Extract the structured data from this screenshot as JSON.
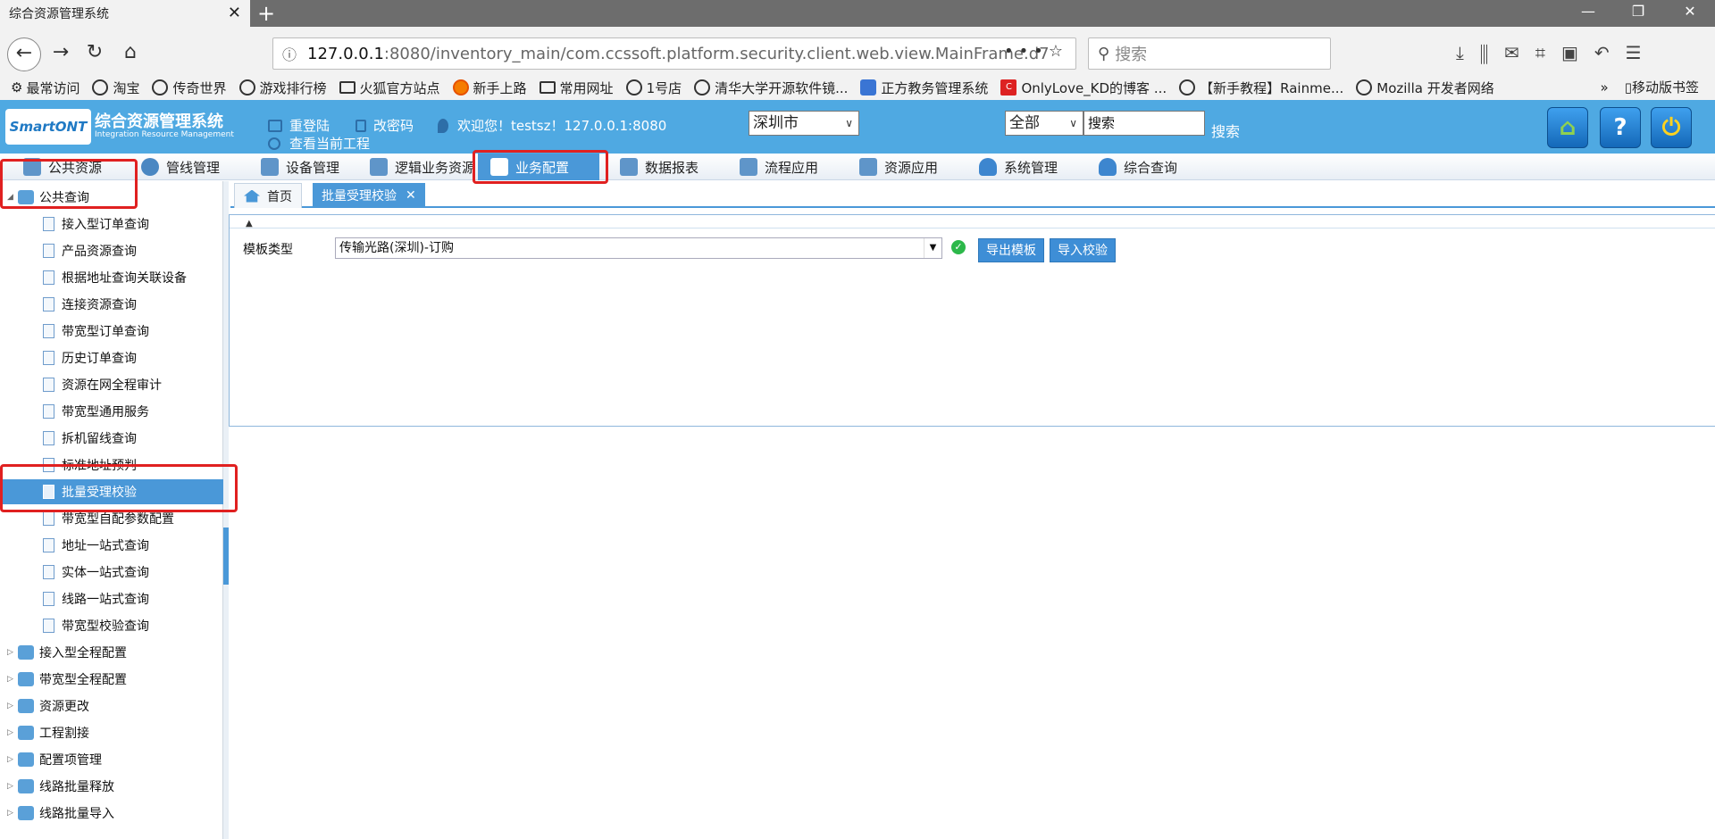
{
  "browser": {
    "tab_title": "综合资源管理系统",
    "url_host": "127.0.0.1",
    "url_rest": ":8080/inventory_main/com.ccssoft.platform.security.client.web.view.MainFrame.d7",
    "search_placeholder": "搜索",
    "bookmarks": [
      "最常访问",
      "淘宝",
      "传奇世界",
      "游戏排行榜",
      "火狐官方站点",
      "新手上路",
      "常用网址",
      "1号店",
      "清华大学开源软件镜...",
      "正方教务管理系统",
      "OnlyLove_KD的博客 ...",
      "【新手教程】Rainme...",
      "Mozilla 开发者网络"
    ],
    "bookmarks_more": "移动版书签"
  },
  "app": {
    "logo_text": "SmartONT",
    "title": "综合资源管理系统",
    "subtitle": "Integration Resource Management",
    "relogin": "重登陆",
    "change_password": "改密码",
    "welcome": "欢迎您！testsz！127.0.0.1:8080",
    "current_project": "查看当前工程",
    "city": "深圳市",
    "scope": "全部",
    "search_value": "搜索",
    "search_button": "搜索"
  },
  "modules": [
    "公共资源",
    "管线管理",
    "设备管理",
    "逻辑业务资源",
    "业务配置",
    "数据报表",
    "流程应用",
    "资源应用",
    "系统管理",
    "综合查询"
  ],
  "tree": {
    "root": "公共查询",
    "leaves": [
      "接入型订单查询",
      "产品资源查询",
      "根据地址查询关联设备",
      "连接资源查询",
      "带宽型订单查询",
      "历史订单查询",
      "资源在网全程审计",
      "带宽型通用服务",
      "拆机留线查询",
      "标准地址预判",
      "批量受理校验",
      "带宽型自配参数配置",
      "地址一站式查询",
      "实体一站式查询",
      "线路一站式查询",
      "带宽型校验查询"
    ],
    "groups": [
      "接入型全程配置",
      "带宽型全程配置",
      "资源更改",
      "工程割接",
      "配置项管理",
      "线路批量释放",
      "线路批量导入"
    ]
  },
  "content": {
    "home_tab": "首页",
    "current_tab": "批量受理校验",
    "template_label": "模板类型",
    "template_value": "传输光路(深圳)-订购",
    "export_button": "导出模板",
    "import_button": "导入校验"
  }
}
